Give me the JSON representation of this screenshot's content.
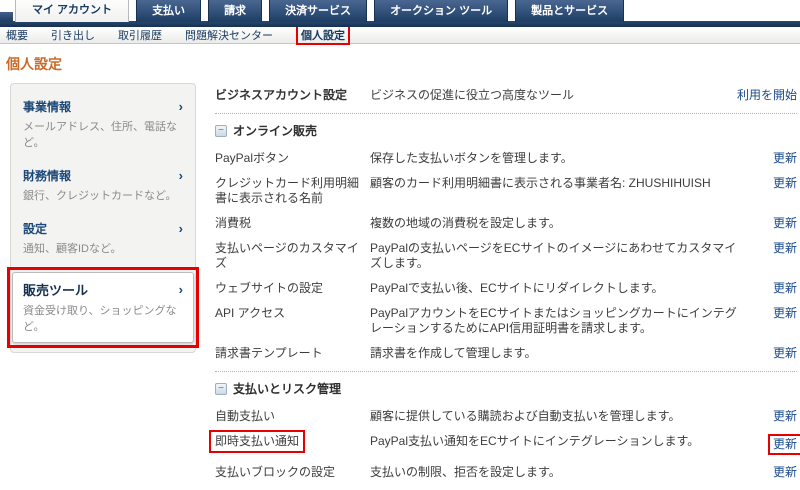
{
  "tabs": {
    "items": [
      {
        "label": "マイ アカウント",
        "active": true
      },
      {
        "label": "支払い",
        "active": false
      },
      {
        "label": "請求",
        "active": false
      },
      {
        "label": "決済サービス",
        "active": false
      },
      {
        "label": "オークション ツール",
        "active": false
      },
      {
        "label": "製品とサービス",
        "active": false
      }
    ]
  },
  "subnav": {
    "items": [
      "概要",
      "引き出し",
      "取引履歴",
      "問題解決センター"
    ],
    "current": "個人設定"
  },
  "page_title": "個人設定",
  "sidebar": {
    "items": [
      {
        "title": "事業情報",
        "subtitle": "メールアドレス、住所、電話など。",
        "chevron": "›"
      },
      {
        "title": "財務情報",
        "subtitle": "銀行、クレジットカードなど。",
        "chevron": "›"
      },
      {
        "title": "設定",
        "subtitle": "通知、顧客IDなど。",
        "chevron": "›"
      }
    ],
    "selected": {
      "title": "販売ツール",
      "subtitle": "資金受け取り、ショッピングなど。",
      "chevron": "›"
    }
  },
  "main": {
    "business_row": {
      "label": "ビジネスアカウント設定",
      "desc": "ビジネスの促進に役立つ高度なツール",
      "link": "利用を開始"
    },
    "sections": [
      {
        "title": "オンライン販売",
        "collapse_icon": "−",
        "rows": [
          {
            "label": "PayPalボタン",
            "desc": "保存した支払いボタンを管理します。",
            "link": "更新"
          },
          {
            "label": "クレジットカード利用明細書に表示される名前",
            "desc": "顧客のカード利用明細書に表示される事業者名: ZHUSHIHUISH",
            "link": "更新"
          },
          {
            "label": "消費税",
            "desc": "複数の地域の消費税を設定します。",
            "link": "更新"
          },
          {
            "label": "支払いページのカスタマイズ",
            "desc": "PayPalの支払いページをECサイトのイメージにあわせてカスタマイズします。",
            "link": "更新"
          },
          {
            "label": "ウェブサイトの設定",
            "desc": "PayPalで支払い後、ECサイトにリダイレクトします。",
            "link": "更新"
          },
          {
            "label": "API アクセス",
            "desc": "PayPalアカウントをECサイトまたはショッピングカートにインテグレーションするためにAPI信用証明書を請求します。",
            "link": "更新"
          },
          {
            "label": "請求書テンプレート",
            "desc": "請求書を作成して管理します。",
            "link": "更新"
          }
        ]
      },
      {
        "title": "支払いとリスク管理",
        "collapse_icon": "−",
        "rows": [
          {
            "label": "自動支払い",
            "desc": "顧客に提供している購読および自動支払いを管理します。",
            "link": "更新"
          },
          {
            "label": "即時支払い通知",
            "desc": "PayPal支払い通知をECサイトにインテグレーションします。",
            "link": "更新"
          },
          {
            "label": "支払いブロックの設定",
            "desc": "支払いの制限、拒否を設定します。",
            "link": "更新"
          }
        ]
      }
    ]
  },
  "colors": {
    "accent_orange": "#d4632a",
    "title_orange": "#c96a28",
    "nav_navy": "#1e3d63",
    "link_blue": "#1b4b8f",
    "annotation_red": "#e60000"
  }
}
